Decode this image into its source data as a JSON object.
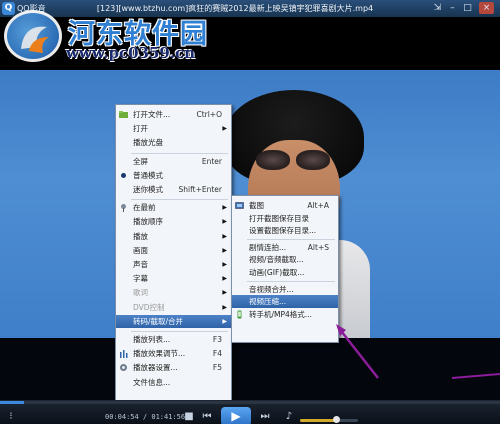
{
  "app": {
    "name": "QQ影音",
    "window_title": "[123][www.btzhu.com]疯狂的赛贼2012最新上映吴镇宇犯罪喜剧大片.mp4"
  },
  "titlebar_buttons": [
    "pin-icon",
    "minimize-icon",
    "maximize-icon",
    "close-icon"
  ],
  "watermark": {
    "title": "河东软件园",
    "url": "www.pc0359.cn"
  },
  "main_menu": {
    "items": [
      {
        "label": "打开文件...",
        "shortcut": "Ctrl+O",
        "icon": "folder-icon"
      },
      {
        "label": "打开",
        "submenu": true
      },
      {
        "label": "播放光盘"
      },
      {
        "sep": true
      },
      {
        "label": "全屏",
        "shortcut": "Enter"
      },
      {
        "label": "普通模式",
        "checked": true
      },
      {
        "label": "迷你模式",
        "shortcut": "Shift+Enter"
      },
      {
        "sep": true
      },
      {
        "label": "在最前",
        "submenu": true,
        "icon": "pin-icon"
      },
      {
        "label": "播放顺序",
        "submenu": true
      },
      {
        "label": "播放",
        "submenu": true
      },
      {
        "label": "画面",
        "submenu": true
      },
      {
        "label": "声音",
        "submenu": true
      },
      {
        "label": "字幕",
        "submenu": true
      },
      {
        "label": "歌词",
        "submenu": true,
        "disabled": true
      },
      {
        "label": "DVD控制",
        "submenu": true,
        "disabled": true
      },
      {
        "label": "转码/截取/合并",
        "submenu": true,
        "highlighted": true
      },
      {
        "sep": true
      },
      {
        "label": "播放列表...",
        "shortcut": "F3"
      },
      {
        "label": "播放效果调节...",
        "shortcut": "F4",
        "icon": "equalizer-icon"
      },
      {
        "label": "播放器设置...",
        "shortcut": "F5",
        "icon": "settings-icon"
      },
      {
        "label": "文件信息..."
      }
    ]
  },
  "sub_menu": {
    "items": [
      {
        "label": "截图",
        "shortcut": "Alt+A",
        "icon": "screenshot-icon"
      },
      {
        "label": "打开截图保存目录"
      },
      {
        "label": "设置截图保存目录..."
      },
      {
        "sep": true
      },
      {
        "label": "剧情连拍...",
        "shortcut": "Alt+S"
      },
      {
        "label": "视频/音频截取..."
      },
      {
        "label": "动画(GIF)截取..."
      },
      {
        "sep": true
      },
      {
        "label": "音视频合并..."
      },
      {
        "label": "视频压缩...",
        "highlighted": true
      },
      {
        "label": "转手机/MP4格式...",
        "icon": "phone-convert-icon"
      }
    ]
  },
  "player": {
    "time": "00:04:54 / 01:41:56",
    "progress": 0.048,
    "volume": 0.62,
    "buttons": [
      "stop-icon",
      "previous-icon",
      "play-icon",
      "next-icon",
      "volume-icon"
    ]
  },
  "colors": {
    "menu_highlight": "#2f63a8",
    "annotation": "#8b1d9a",
    "titlebar": "#1f3d60",
    "video_background": "#4a88cf"
  }
}
